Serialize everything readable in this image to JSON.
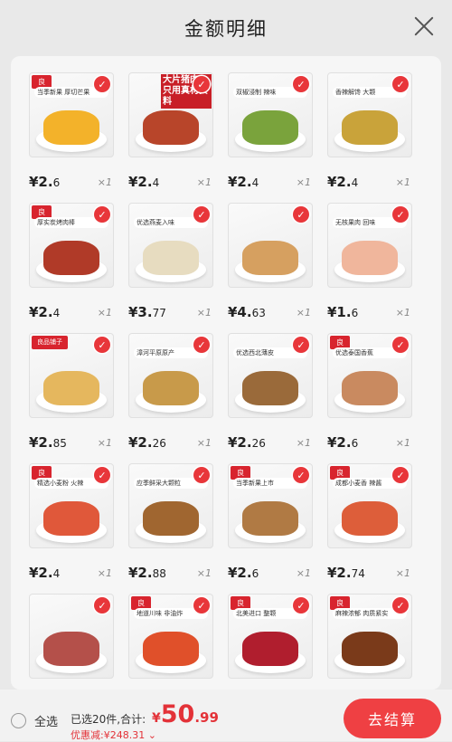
{
  "header": {
    "title": "金额明细"
  },
  "products": [
    {
      "price_int": "¥2.",
      "price_dec": "6",
      "qty": "×1",
      "brand": "良",
      "tagline": "当季新果 厚切芒果",
      "color": "#f5b82e",
      "colors": {
        "food": "#f3b22a"
      }
    },
    {
      "price_int": "¥2.",
      "price_dec": "4",
      "qty": "×1",
      "brand": "",
      "tagline": "",
      "big": "大片猪肉 只用真材实料",
      "color": "#c81f27",
      "colors": {
        "food": "#b8452a"
      }
    },
    {
      "price_int": "¥2.",
      "price_dec": "4",
      "qty": "×1",
      "brand": "",
      "tagline": "双椒浸制 辣味",
      "color": "#6a9a2f",
      "colors": {
        "food": "#7aa33c"
      }
    },
    {
      "price_int": "¥2.",
      "price_dec": "4",
      "qty": "×1",
      "brand": "",
      "tagline": "香辣解馋 大颗",
      "color": "#c9a33a",
      "colors": {
        "food": "#c9a33a"
      }
    },
    {
      "price_int": "¥2.",
      "price_dec": "4",
      "qty": "×1",
      "brand": "良",
      "tagline": "厚实炭烤肉棒",
      "color": "#b8402a",
      "colors": {
        "food": "#b03a28"
      }
    },
    {
      "price_int": "¥3.",
      "price_dec": "77",
      "qty": "×1",
      "brand": "",
      "tagline": "优选燕麦入味",
      "color": "#e8dcc0",
      "colors": {
        "food": "#e7dcc0"
      }
    },
    {
      "price_int": "¥4.",
      "price_dec": "63",
      "qty": "×1",
      "brand": "",
      "tagline": "",
      "color": "#d9a05a",
      "colors": {
        "food": "#d6a060"
      }
    },
    {
      "price_int": "¥1.",
      "price_dec": "6",
      "qty": "×1",
      "brand": "",
      "tagline": "无核果肉 回味",
      "color": "#f0b6a0",
      "colors": {
        "food": "#f0b69c"
      }
    },
    {
      "price_int": "¥2.",
      "price_dec": "85",
      "qty": "×1",
      "brand": "良品铺子",
      "tagline": "",
      "color": "#e6b860",
      "colors": {
        "food": "#e5b75e"
      }
    },
    {
      "price_int": "¥2.",
      "price_dec": "26",
      "qty": "×1",
      "brand": "",
      "tagline": "漳河平原原产",
      "color": "#c99a4a",
      "colors": {
        "food": "#c89a4a"
      }
    },
    {
      "price_int": "¥2.",
      "price_dec": "26",
      "qty": "×1",
      "brand": "",
      "tagline": "优选西北薄皮",
      "color": "#9a6a3a",
      "colors": {
        "food": "#9a6a3a"
      }
    },
    {
      "price_int": "¥2.",
      "price_dec": "6",
      "qty": "×1",
      "brand": "良",
      "tagline": "优选泰国香蕉",
      "color": "#c98a60",
      "colors": {
        "food": "#c98a60"
      }
    },
    {
      "price_int": "¥2.",
      "price_dec": "4",
      "qty": "×1",
      "brand": "良",
      "tagline": "精选小麦粉 火辣",
      "color": "#e05a3a",
      "colors": {
        "food": "#e0583a"
      }
    },
    {
      "price_int": "¥2.",
      "price_dec": "88",
      "qty": "×1",
      "brand": "",
      "tagline": "应季鲜采大颗粒",
      "color": "#a0662e",
      "colors": {
        "food": "#a06630"
      }
    },
    {
      "price_int": "¥2.",
      "price_dec": "6",
      "qty": "×1",
      "brand": "良",
      "tagline": "当季新果上市",
      "color": "#b07a44",
      "colors": {
        "food": "#b07a44"
      }
    },
    {
      "price_int": "¥2.",
      "price_dec": "74",
      "qty": "×1",
      "brand": "良",
      "tagline": "成都小麦香 辣酱",
      "color": "#e0603a",
      "colors": {
        "food": "#dd5e3a"
      }
    },
    {
      "price_int": "",
      "price_dec": "",
      "qty": "",
      "brand": "",
      "tagline": "",
      "color": "#b4504a",
      "colors": {
        "food": "#b4504a"
      }
    },
    {
      "price_int": "",
      "price_dec": "",
      "qty": "",
      "brand": "良",
      "tagline": "地道川味 非油炸",
      "color": "#e0502a",
      "colors": {
        "food": "#e0502a"
      }
    },
    {
      "price_int": "",
      "price_dec": "",
      "qty": "",
      "brand": "良",
      "tagline": "北美进口 整颗",
      "color": "#b01e2e",
      "colors": {
        "food": "#b01e2e"
      }
    },
    {
      "price_int": "",
      "price_dec": "",
      "qty": "",
      "brand": "良",
      "tagline": "麻辣浓郁 肉质紧实",
      "color": "#7a3a1a",
      "colors": {
        "food": "#7a3a1a"
      }
    }
  ],
  "footer": {
    "select_all": "全选",
    "summary": "已选20件,合计:",
    "currency": "¥",
    "total_int": "50",
    "total_dec": ".99",
    "discount": "优惠减:¥248.31 ⌄",
    "checkout": "去结算"
  }
}
